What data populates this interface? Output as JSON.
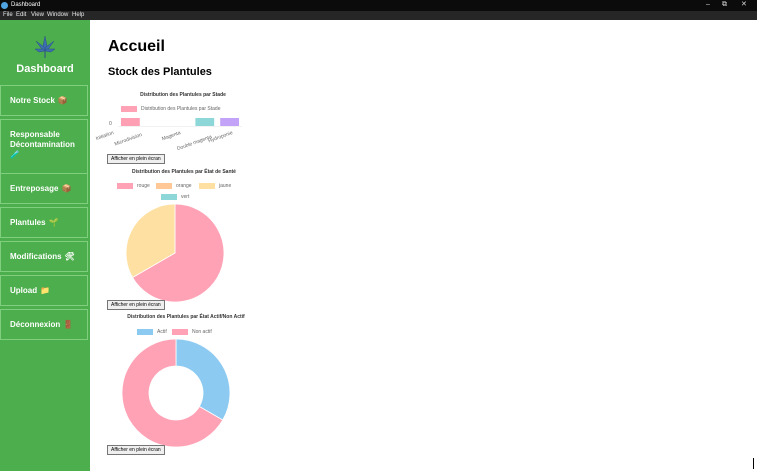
{
  "window": {
    "title": "Dashboard",
    "minimize": "–",
    "restore": "⧉",
    "close": "✕"
  },
  "menu": [
    "File",
    "Edit",
    "View",
    "Window",
    "Help"
  ],
  "sidebar": {
    "brand": "Dashboard",
    "items": [
      {
        "label": "Notre Stock",
        "icon": "📦"
      },
      {
        "label": "Responsable Décontamination",
        "icon": "🧪"
      },
      {
        "label": "Entreposage",
        "icon": "📦"
      },
      {
        "label": "Plantules",
        "icon": "🌱"
      },
      {
        "label": "Modifications",
        "icon": "🛠"
      },
      {
        "label": "Upload",
        "icon": "📁"
      },
      {
        "label": "Déconnexion",
        "icon": "🚪"
      }
    ]
  },
  "main": {
    "title": "Accueil",
    "subtitle": "Stock des Plantules",
    "fullscreen_label": "Afficher en plein écran"
  },
  "chart_data": [
    {
      "type": "bar",
      "title": "Distribution des Plantules par Stade",
      "series": [
        {
          "name": "Distribution des Plantules par Stade",
          "values": [
            1,
            0,
            0,
            1,
            1
          ]
        }
      ],
      "categories": [
        "Initiation",
        "Microdivision",
        "Magenta",
        "Double magenta",
        "Hydroponie"
      ],
      "bar_colors": [
        "#ff9fb4",
        "#ffbe8a",
        "#ffe0a0",
        "#8ed7d9",
        "#c3a3f7"
      ],
      "y_ticks": [
        "0"
      ]
    },
    {
      "type": "pie",
      "title": "Distribution des Plantules par État de Santé",
      "labels": [
        "rouge",
        "orange",
        "jaune",
        "vert"
      ],
      "values": [
        2,
        0,
        1,
        0
      ],
      "colors": [
        "#ffa2b5",
        "#ffc896",
        "#ffe0a3",
        "#8ed7d9"
      ]
    },
    {
      "type": "pie",
      "title": "Distribution des Plantules par État Actif/Non Actif",
      "labels": [
        "Actif",
        "Non actif"
      ],
      "values": [
        1,
        2
      ],
      "colors": [
        "#8ccaf2",
        "#ffa2b5"
      ]
    }
  ]
}
